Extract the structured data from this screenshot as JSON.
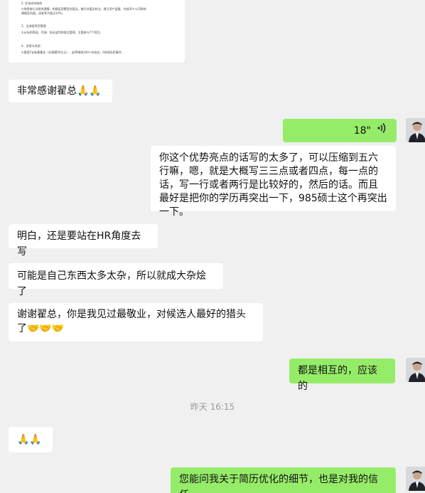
{
  "doc_card": {
    "lines": [
      "2. 优化成本结构",
      "①熟悉各行业财务建模，构建运用模型估值法，推行估值比较法，建立资产监督，完成30+公司财务",
      "建模及估值，误差率不超过10%。",
      "3、全流程项目管理",
      "①从标的筛选、尽调、协议谈判到投后管理，主要参与7个项目。",
      "4、合规与风控：",
      "①管理7支私募基金（总规模50亿元），起草审核100+份协议，0合规风险事件。"
    ]
  },
  "messages": {
    "m1": "非常感谢翟总🙏🙏",
    "voice_duration": "18\"",
    "m3": "你这个优势亮点的话写的太多了，可以压缩到五六行嘛，嗯，就是大概写三三点或者四点，每一点的话，写一行或者两行是比较好的，然后的话。而且最好是把你的学历再突出一下，985硕士这个再突出一下。",
    "m4": "明白，还是要站在HR角度去写",
    "m5": "可能是自己东西太多太杂，所以就成大杂烩了",
    "m6": "谢谢翟总，你是我见过最敬业，对候选人最好的猎头了🤝🤝🤝",
    "m7": "都是相互的，应该的",
    "time_label": "昨天 16:15",
    "m8": "🙏🙏",
    "m9": "您能问我关于简历优化的细节，也是对我的信任"
  },
  "colors": {
    "background": "#f0f0f0",
    "incoming_bubble": "#ffffff",
    "outgoing_bubble": "#95ec69"
  },
  "icons": {
    "voice": "voice-wave-icon",
    "avatar": "user-avatar-icon"
  }
}
